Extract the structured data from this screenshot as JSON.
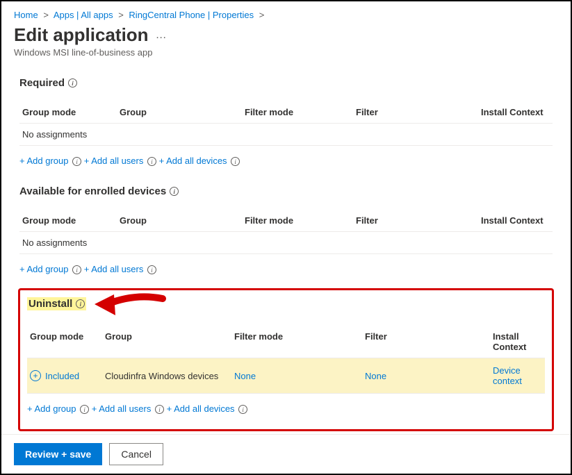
{
  "breadcrumb": {
    "items": [
      "Home",
      "Apps | All apps",
      "RingCentral Phone | Properties"
    ],
    "sep": ">"
  },
  "header": {
    "title": "Edit application",
    "subtitle": "Windows MSI line-of-business app"
  },
  "columns": {
    "mode": "Group mode",
    "group": "Group",
    "fmode": "Filter mode",
    "filter": "Filter",
    "ctx": "Install Context"
  },
  "no_assignments": "No assignments",
  "sections": {
    "required": {
      "title": "Required",
      "actions": [
        "+ Add group",
        "+ Add all users",
        "+ Add all devices"
      ]
    },
    "available": {
      "title": "Available for enrolled devices",
      "actions": [
        "+ Add group",
        "+ Add all users"
      ]
    },
    "uninstall": {
      "title": "Uninstall",
      "row": {
        "mode": "Included",
        "group": "Cloudinfra Windows devices",
        "fmode": "None",
        "filter": "None",
        "ctx": "Device context"
      },
      "actions": [
        "+ Add group",
        "+ Add all users",
        "+ Add all devices"
      ]
    }
  },
  "footer": {
    "primary": "Review + save",
    "secondary": "Cancel"
  }
}
